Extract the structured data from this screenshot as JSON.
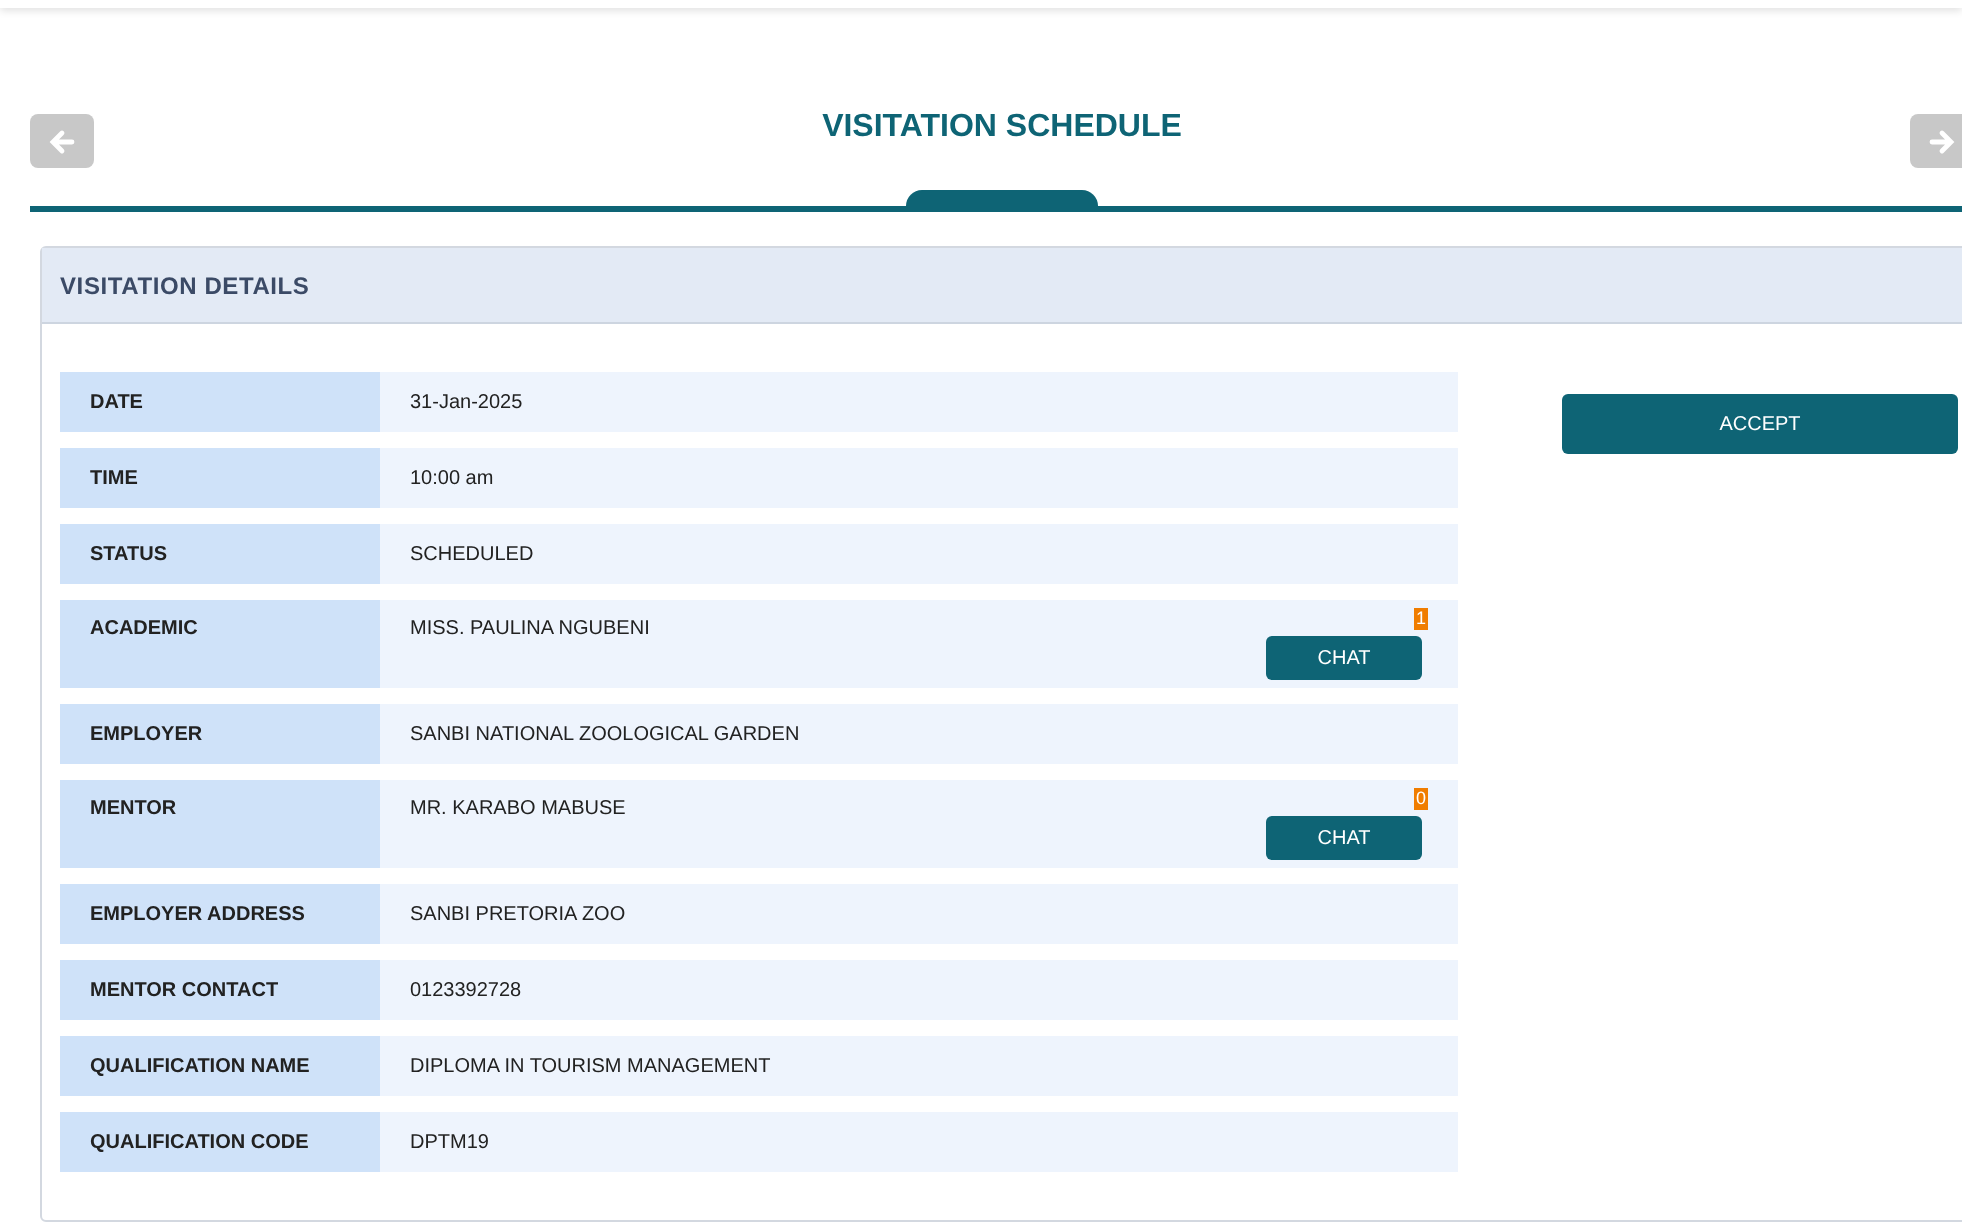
{
  "header": {
    "title": "VISITATION SCHEDULE"
  },
  "panel": {
    "title": "VISITATION DETAILS"
  },
  "details": [
    {
      "label": "DATE",
      "value": "31-Jan-2025"
    },
    {
      "label": "TIME",
      "value": "10:00 am"
    },
    {
      "label": "STATUS",
      "value": "SCHEDULED"
    },
    {
      "label": "ACADEMIC",
      "value": "MISS. PAULINA NGUBENI",
      "chat": {
        "label": "CHAT",
        "badge": "1"
      }
    },
    {
      "label": "EMPLOYER",
      "value": "SANBI NATIONAL ZOOLOGICAL GARDEN"
    },
    {
      "label": "MENTOR",
      "value": "MR. KARABO MABUSE",
      "chat": {
        "label": "CHAT",
        "badge": "0"
      }
    },
    {
      "label": "EMPLOYER ADDRESS",
      "value": "SANBI PRETORIA ZOO"
    },
    {
      "label": "MENTOR CONTACT",
      "value": "0123392728"
    },
    {
      "label": "QUALIFICATION NAME",
      "value": "DIPLOMA IN TOURISM MANAGEMENT"
    },
    {
      "label": "QUALIFICATION CODE",
      "value": "DPTM19"
    }
  ],
  "actions": [
    {
      "label": "ACCEPT"
    }
  ]
}
